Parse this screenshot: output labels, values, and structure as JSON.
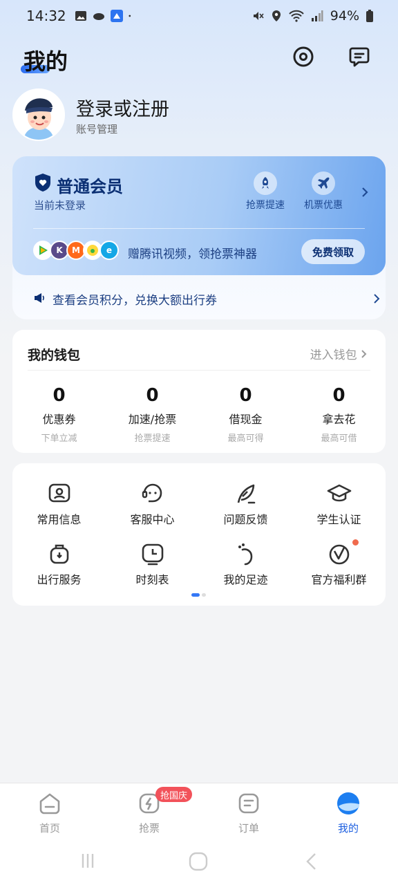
{
  "status_bar": {
    "time": "14:32",
    "battery": "94%"
  },
  "header": {
    "title": "我的",
    "settings_icon": "settings-ring-icon",
    "message_icon": "chat-bubble-icon"
  },
  "profile": {
    "login_label": "登录或注册",
    "account_label": "账号管理"
  },
  "member_card": {
    "tier": "普通会员",
    "status": "当前未登录",
    "perks": [
      {
        "label": "抢票提速",
        "icon": "rocket-icon"
      },
      {
        "label": "机票优惠",
        "icon": "airplane-icon"
      }
    ],
    "promo_text": "赠腾讯视频，领抢票神器",
    "promo_button": "免费领取",
    "points_text": "查看会员积分，兑换大额出行券"
  },
  "wallet": {
    "title": "我的钱包",
    "link": "进入钱包",
    "items": [
      {
        "value": "0",
        "label": "优惠券",
        "sub": "下单立减"
      },
      {
        "value": "0",
        "label": "加速/抢票",
        "sub": "抢票提速"
      },
      {
        "value": "0",
        "label": "借现金",
        "sub": "最高可得"
      },
      {
        "value": "0",
        "label": "拿去花",
        "sub": "最高可借"
      }
    ]
  },
  "services": [
    {
      "label": "常用信息",
      "icon": "contact-card-icon"
    },
    {
      "label": "客服中心",
      "icon": "customer-service-icon"
    },
    {
      "label": "问题反馈",
      "icon": "feather-pen-icon"
    },
    {
      "label": "学生认证",
      "icon": "graduation-cap-icon"
    },
    {
      "label": "出行服务",
      "icon": "luggage-icon"
    },
    {
      "label": "时刻表",
      "icon": "clock-icon"
    },
    {
      "label": "我的足迹",
      "icon": "footprint-icon"
    },
    {
      "label": "官方福利群",
      "icon": "welfare-group-icon"
    }
  ],
  "bottom_nav": {
    "items": [
      {
        "label": "首页",
        "icon": "home-icon"
      },
      {
        "label": "抢票",
        "icon": "lightning-ticket-icon"
      },
      {
        "label": "订单",
        "icon": "order-list-icon"
      },
      {
        "label": "我的",
        "icon": "profile-cloud-icon"
      }
    ],
    "badge": "抢国庆",
    "active_index": 3
  },
  "colors": {
    "accent": "#1d5fe0",
    "member_card_dark": "#0b2f73",
    "badge_red": "#f2525a"
  }
}
